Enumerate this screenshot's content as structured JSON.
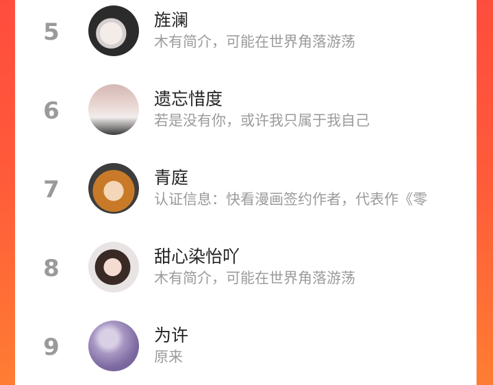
{
  "list": {
    "items": [
      {
        "rank": "5",
        "name": "旌澜",
        "desc": "木有简介，可能在世界角落游荡",
        "avatar_icon": "avatar-icon"
      },
      {
        "rank": "6",
        "name": "遗忘惜度",
        "desc": "若是没有你，或许我只属于我自己",
        "avatar_icon": "avatar-icon"
      },
      {
        "rank": "7",
        "name": "青庭",
        "desc": "认证信息：快看漫画签约作者，代表作《零",
        "avatar_icon": "avatar-icon"
      },
      {
        "rank": "8",
        "name": "甜心染怡吖",
        "desc": "木有简介，可能在世界角落游荡",
        "avatar_icon": "avatar-icon"
      },
      {
        "rank": "9",
        "name": "为许",
        "desc": "原来",
        "avatar_icon": "avatar-icon"
      }
    ]
  },
  "colors": {
    "background_gradient_top": "#ff4d3d",
    "background_gradient_bottom": "#ff7d32",
    "rank_color": "#9a9a9a",
    "name_color": "#222222",
    "desc_color": "#9b9b9b"
  }
}
